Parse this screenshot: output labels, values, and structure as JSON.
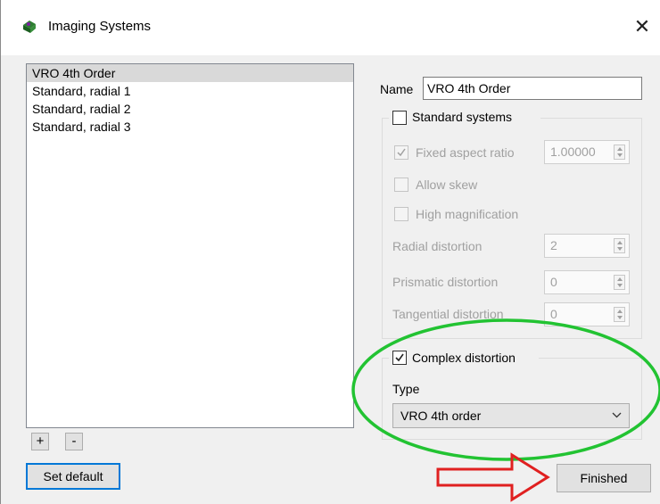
{
  "window": {
    "title": "Imaging Systems",
    "close_glyph": "✕",
    "icon": "camera-icon"
  },
  "systems_list": {
    "items": [
      "VRO 4th Order",
      "Standard, radial 1",
      "Standard, radial 2",
      "Standard, radial 3"
    ],
    "selected_index": 0
  },
  "list_buttons": {
    "add": "+",
    "remove": "-"
  },
  "set_default_label": "Set default",
  "finished_label": "Finished",
  "name": {
    "label": "Name",
    "value": "VRO 4th Order"
  },
  "standard": {
    "label": "Standard systems",
    "checked": false,
    "fixed_aspect": {
      "label": "Fixed aspect ratio",
      "checked": true,
      "value": "1.00000"
    },
    "allow_skew": {
      "label": "Allow skew",
      "checked": false
    },
    "high_mag": {
      "label": "High magnification",
      "checked": false
    },
    "radial": {
      "label": "Radial distortion",
      "value": "2"
    },
    "prismatic": {
      "label": "Prismatic distortion",
      "value": "0"
    },
    "tangential": {
      "label": "Tangential distortion",
      "value": "0"
    }
  },
  "complex": {
    "label": "Complex distortion",
    "checked": true,
    "type_label": "Type",
    "type_value": "VRO 4th order"
  },
  "annotations": {
    "ellipse_color": "#22c332",
    "arrow_color": "#e02020"
  }
}
